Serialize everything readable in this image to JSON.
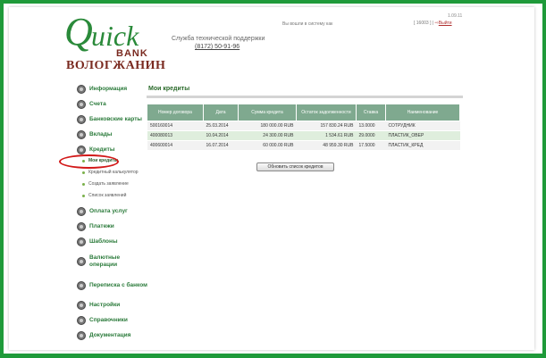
{
  "header": {
    "logo": {
      "q": "Q",
      "uick": "uick",
      "bank": "BANK",
      "region": "ВОЛОГЖАНИН"
    },
    "support_label": "Служба технической поддержки",
    "support_phone": "(8172) 50-91-96",
    "welcome": "Вы вошли в систему как",
    "user_id": "[ 16003 ]",
    "separator": "|",
    "exit_label": "Выйти",
    "version": "1.09.11"
  },
  "sidebar": {
    "items": [
      {
        "label": "Информация"
      },
      {
        "label": "Счета"
      },
      {
        "label": "Банковские карты"
      },
      {
        "label": "Вклады"
      },
      {
        "label": "Кредиты"
      }
    ],
    "credit_subitems": [
      {
        "label": "Мои кредиты",
        "active": true
      },
      {
        "label": "Кредитный калькулятор"
      },
      {
        "label": "Создать заявление"
      },
      {
        "label": "Список заявлений"
      }
    ],
    "items_after": [
      {
        "label": "Оплата услуг"
      },
      {
        "label": "Платежи"
      },
      {
        "label": "Шаблоны"
      },
      {
        "label": "Валютные операции"
      },
      {
        "label": "Переписка с банком"
      },
      {
        "label": "Настройки"
      },
      {
        "label": "Справочники"
      },
      {
        "label": "Документация"
      }
    ]
  },
  "main": {
    "title": "Мои кредиты",
    "table": {
      "columns": [
        "Номер договора",
        "Дата",
        "Сумма кредита",
        "Остаток задолженности",
        "Ставка",
        "Наименование"
      ],
      "rows": [
        [
          "500160014",
          "25.03.2014",
          "180 000.00 RUB",
          "157 830.24 RUB",
          "13.0000",
          "СОТРУДНИК"
        ],
        [
          "400080013",
          "10.04.2014",
          "24 300.00 RUB",
          "1 534.61 RUB",
          "29.0000",
          "ПЛАСТИК_ОВЕР"
        ],
        [
          "400600014",
          "16.07.2014",
          "60 000.00 RUB",
          "48 959.30 RUB",
          "17.5000",
          "ПЛАСТИК_КРЕД"
        ]
      ]
    },
    "refresh_label": "Обновить список кредитов"
  },
  "colors": {
    "frame": "#1f9a3a",
    "accent": "#2a7a3a",
    "highlight_circle": "#d21919",
    "table_header": "#7fa98f"
  }
}
